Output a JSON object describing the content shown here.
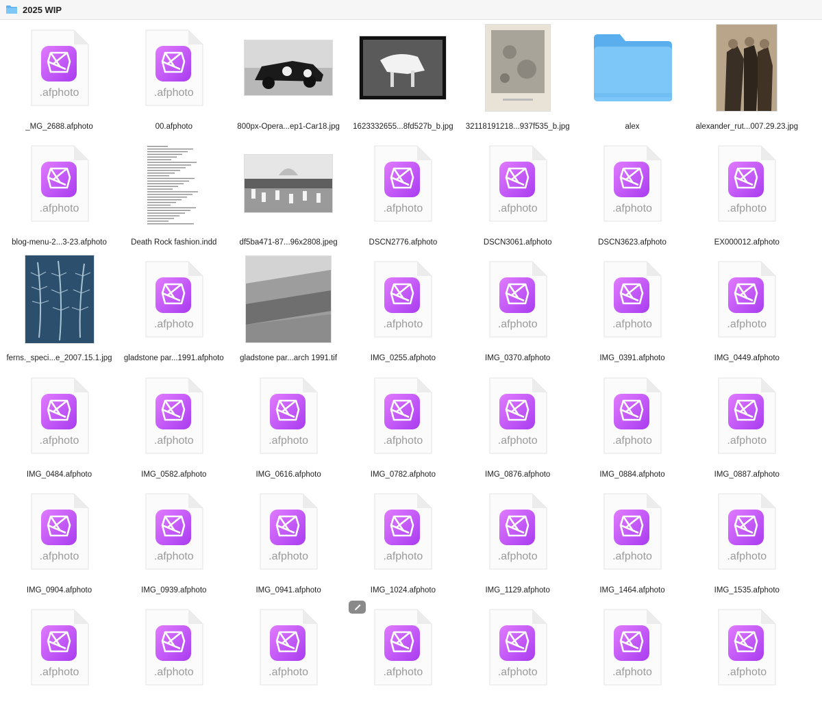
{
  "window": {
    "title": "2025 WIP",
    "title_icon": "folder-icon"
  },
  "icons": {
    "afphoto": "affinity-photo-document-icon",
    "folder": "folder-icon",
    "edit": "pencil-icon"
  },
  "colors": {
    "affinity_purple": "#c44df5",
    "folder_blue": "#6cc1f6"
  },
  "doc_ext": ".afphoto",
  "items": [
    {
      "label": "_MG_2688.afphoto",
      "kind": "afphoto"
    },
    {
      "label": "00.afphoto",
      "kind": "afphoto"
    },
    {
      "label": "800px-Opera...ep1-Car18.jpg",
      "kind": "photo-car"
    },
    {
      "label": "1623332655...8fd527b_b.jpg",
      "kind": "photo-cow"
    },
    {
      "label": "32118191218...937f535_b.jpg",
      "kind": "photo-moon"
    },
    {
      "label": "alex",
      "kind": "folder"
    },
    {
      "label": "alexander_rut...007.29.23.jpg",
      "kind": "photo-men"
    },
    {
      "label": "blog-menu-2...3-23.afphoto",
      "kind": "afphoto"
    },
    {
      "label": "Death Rock fashion.indd",
      "kind": "textdoc"
    },
    {
      "label": "df5ba471-87...96x2808.jpeg",
      "kind": "photo-march"
    },
    {
      "label": "DSCN2776.afphoto",
      "kind": "afphoto"
    },
    {
      "label": "DSCN3061.afphoto",
      "kind": "afphoto"
    },
    {
      "label": "DSCN3623.afphoto",
      "kind": "afphoto"
    },
    {
      "label": "EX000012.afphoto",
      "kind": "afphoto"
    },
    {
      "label": "ferns._speci...e_2007.15.1.jpg",
      "kind": "photo-ferns"
    },
    {
      "label": "gladstone par...1991.afphoto",
      "kind": "afphoto"
    },
    {
      "label": "gladstone par...arch 1991.tif",
      "kind": "photo-land"
    },
    {
      "label": "IMG_0255.afphoto",
      "kind": "afphoto"
    },
    {
      "label": "IMG_0370.afphoto",
      "kind": "afphoto"
    },
    {
      "label": "IMG_0391.afphoto",
      "kind": "afphoto"
    },
    {
      "label": "IMG_0449.afphoto",
      "kind": "afphoto"
    },
    {
      "label": "IMG_0484.afphoto",
      "kind": "afphoto"
    },
    {
      "label": "IMG_0582.afphoto",
      "kind": "afphoto"
    },
    {
      "label": "IMG_0616.afphoto",
      "kind": "afphoto"
    },
    {
      "label": "IMG_0782.afphoto",
      "kind": "afphoto"
    },
    {
      "label": "IMG_0876.afphoto",
      "kind": "afphoto"
    },
    {
      "label": "IMG_0884.afphoto",
      "kind": "afphoto"
    },
    {
      "label": "IMG_0887.afphoto",
      "kind": "afphoto"
    },
    {
      "label": "IMG_0904.afphoto",
      "kind": "afphoto"
    },
    {
      "label": "IMG_0939.afphoto",
      "kind": "afphoto"
    },
    {
      "label": "IMG_0941.afphoto",
      "kind": "afphoto"
    },
    {
      "label": "IMG_1024.afphoto",
      "kind": "afphoto"
    },
    {
      "label": "IMG_1129.afphoto",
      "kind": "afphoto"
    },
    {
      "label": "IMG_1464.afphoto",
      "kind": "afphoto"
    },
    {
      "label": "IMG_1535.afphoto",
      "kind": "afphoto"
    },
    {
      "label": "",
      "kind": "afphoto"
    },
    {
      "label": "",
      "kind": "afphoto"
    },
    {
      "label": "",
      "kind": "afphoto"
    },
    {
      "label": "",
      "kind": "afphoto"
    },
    {
      "label": "",
      "kind": "afphoto"
    },
    {
      "label": "",
      "kind": "afphoto"
    },
    {
      "label": "",
      "kind": "afphoto"
    }
  ]
}
